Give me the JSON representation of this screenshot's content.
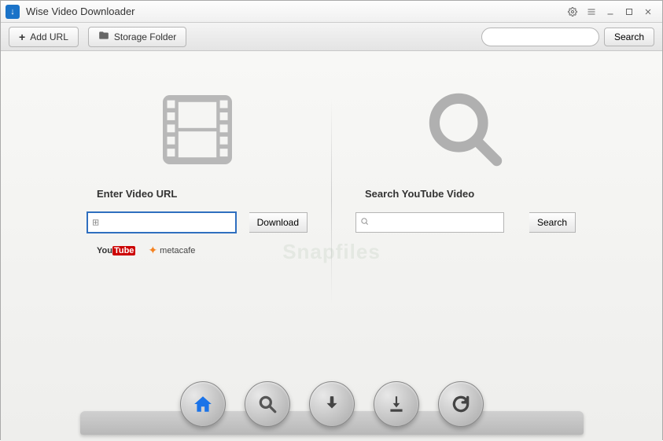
{
  "app": {
    "title": "Wise Video Downloader"
  },
  "toolbar": {
    "add_url_label": "Add URL",
    "storage_folder_label": "Storage Folder",
    "search_button_label": "Search",
    "search_placeholder": ""
  },
  "left_panel": {
    "heading": "Enter Video URL",
    "button_label": "Download",
    "input_value": "",
    "providers": {
      "youtube": "YouTube",
      "metacafe": "metacafe"
    }
  },
  "right_panel": {
    "heading": "Search YouTube Video",
    "button_label": "Search",
    "input_value": ""
  },
  "dock": {
    "home": "home",
    "search": "search",
    "download": "download",
    "download_to_disk": "download-to-disk",
    "refresh": "refresh"
  },
  "watermark": "Snapfiles"
}
